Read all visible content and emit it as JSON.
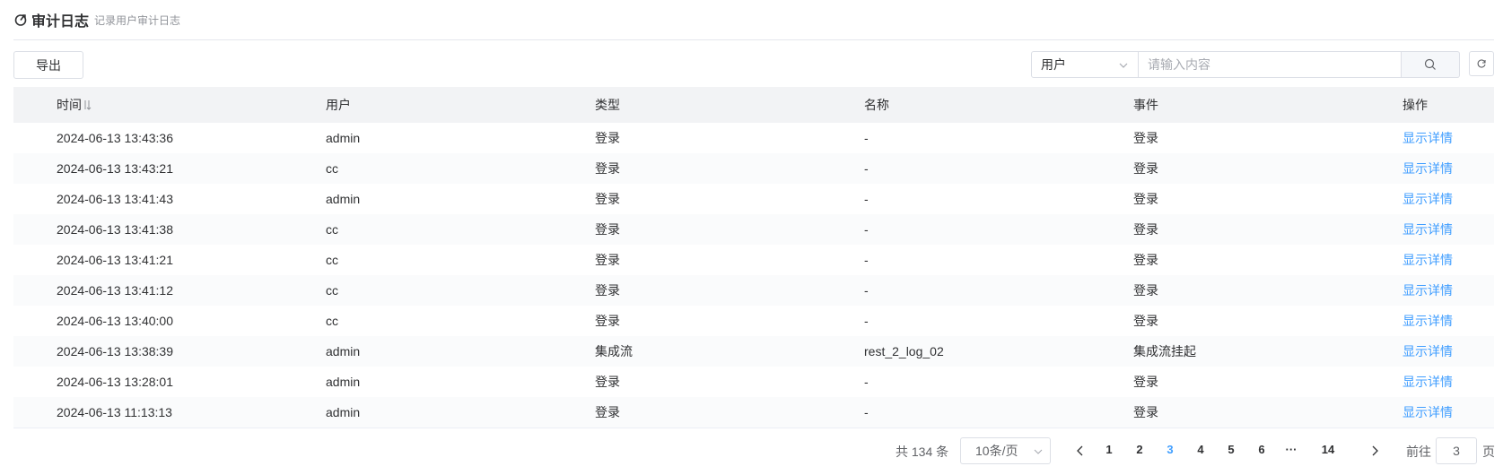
{
  "header": {
    "title": "审计日志",
    "subtitle": "记录用户审计日志"
  },
  "toolbar": {
    "export_label": "导出",
    "filter_select_value": "用户",
    "search_placeholder": "请输入内容"
  },
  "table": {
    "columns": [
      "时间",
      "用户",
      "类型",
      "名称",
      "事件",
      "操作"
    ],
    "rows": [
      {
        "time": "2024-06-13 13:43:36",
        "user": "admin",
        "type": "登录",
        "name": "-",
        "event": "登录",
        "action": "显示详情"
      },
      {
        "time": "2024-06-13 13:43:21",
        "user": "cc",
        "type": "登录",
        "name": "-",
        "event": "登录",
        "action": "显示详情"
      },
      {
        "time": "2024-06-13 13:41:43",
        "user": "admin",
        "type": "登录",
        "name": "-",
        "event": "登录",
        "action": "显示详情"
      },
      {
        "time": "2024-06-13 13:41:38",
        "user": "cc",
        "type": "登录",
        "name": "-",
        "event": "登录",
        "action": "显示详情"
      },
      {
        "time": "2024-06-13 13:41:21",
        "user": "cc",
        "type": "登录",
        "name": "-",
        "event": "登录",
        "action": "显示详情"
      },
      {
        "time": "2024-06-13 13:41:12",
        "user": "cc",
        "type": "登录",
        "name": "-",
        "event": "登录",
        "action": "显示详情"
      },
      {
        "time": "2024-06-13 13:40:00",
        "user": "cc",
        "type": "登录",
        "name": "-",
        "event": "登录",
        "action": "显示详情"
      },
      {
        "time": "2024-06-13 13:38:39",
        "user": "admin",
        "type": "集成流",
        "name": "rest_2_log_02",
        "event": "集成流挂起",
        "action": "显示详情"
      },
      {
        "time": "2024-06-13 13:28:01",
        "user": "admin",
        "type": "登录",
        "name": "-",
        "event": "登录",
        "action": "显示详情"
      },
      {
        "time": "2024-06-13 11:13:13",
        "user": "admin",
        "type": "登录",
        "name": "-",
        "event": "登录",
        "action": "显示详情"
      }
    ]
  },
  "pagination": {
    "total_label": "共 134 条",
    "page_size_label": "10条/页",
    "pages": [
      "1",
      "2",
      "3",
      "4",
      "5",
      "6",
      "···",
      "14"
    ],
    "current_page": "3",
    "goto_prefix": "前往",
    "goto_value": "3",
    "goto_suffix": "页"
  },
  "colors": {
    "accent": "#409eff",
    "header_bg": "#f2f3f5",
    "border": "#dcdfe6"
  }
}
